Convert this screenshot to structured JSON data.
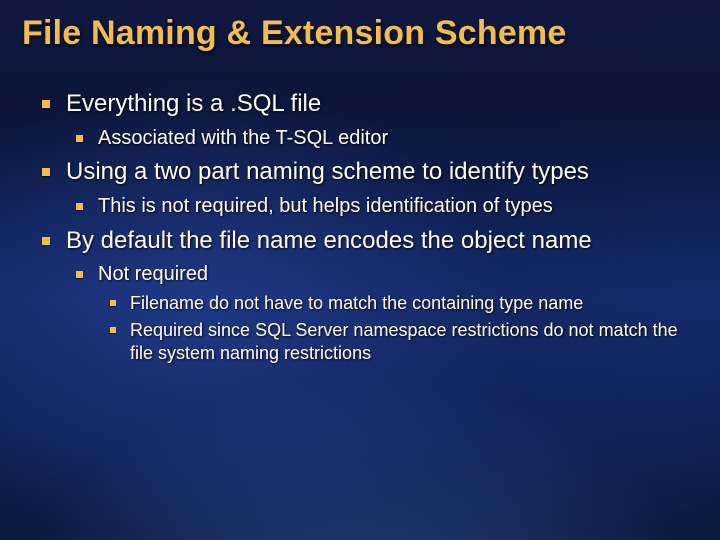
{
  "title": "File Naming & Extension Scheme",
  "bullets": [
    {
      "text": "Everything is a .SQL file",
      "children": [
        {
          "text": "Associated with the T-SQL editor"
        }
      ]
    },
    {
      "text": "Using a two part naming scheme to identify types",
      "children": [
        {
          "text": "This is not required, but helps identification of types"
        }
      ]
    },
    {
      "text": "By default the file name encodes the object name",
      "children": [
        {
          "text": "Not required",
          "children": [
            {
              "text": "Filename do not have to match the containing type name"
            },
            {
              "text": "Required since SQL Server namespace restrictions do not match the file system naming restrictions"
            }
          ]
        }
      ]
    }
  ]
}
